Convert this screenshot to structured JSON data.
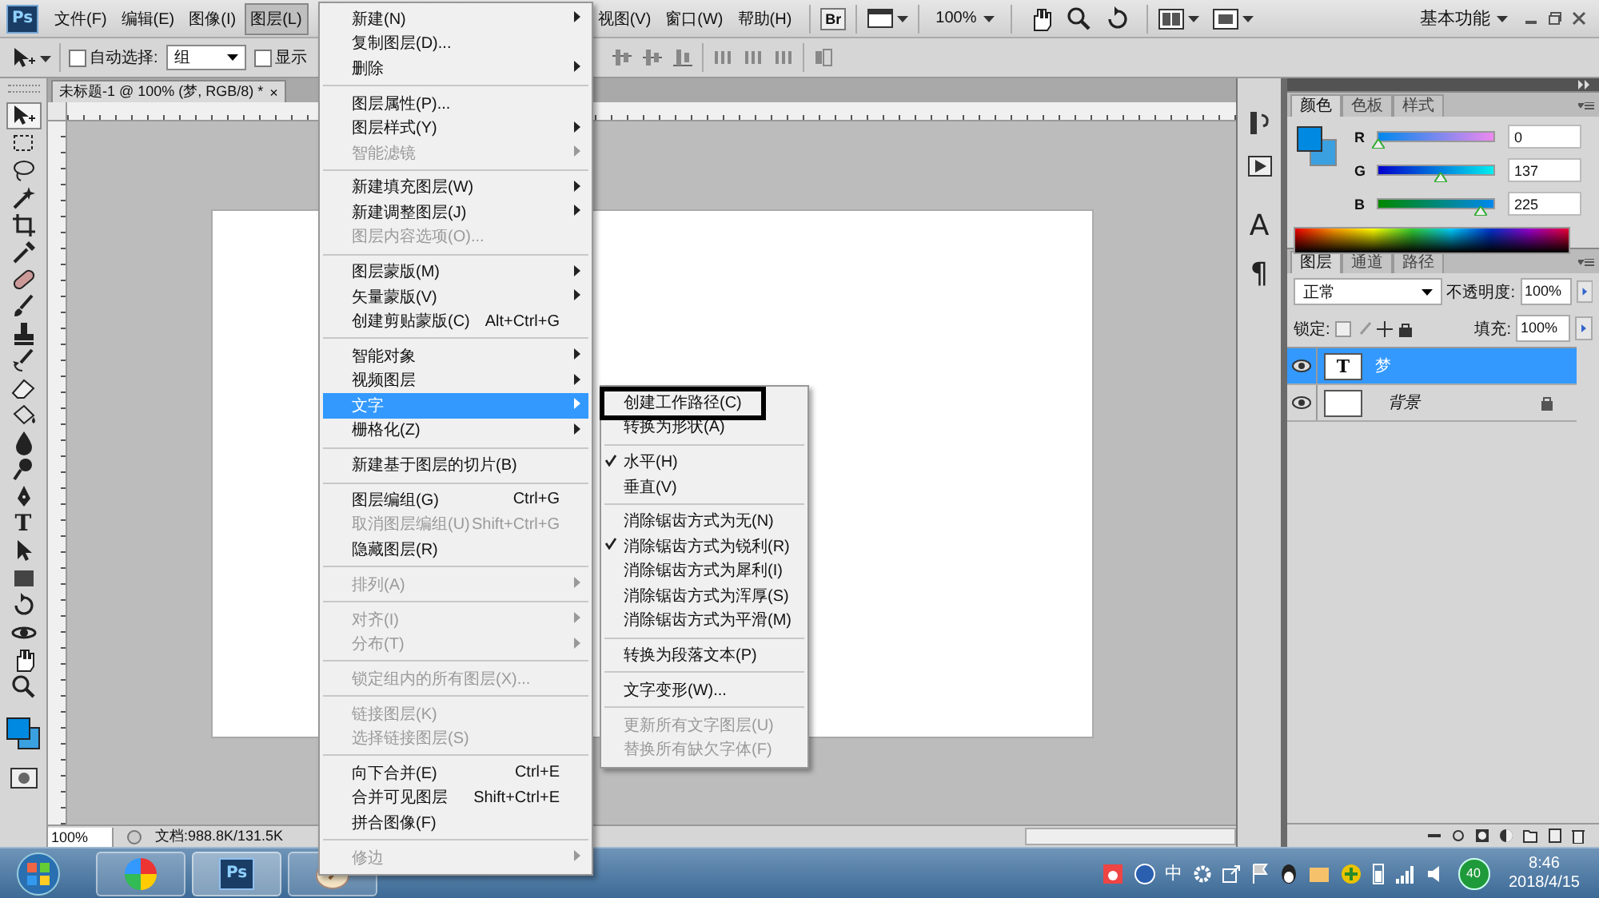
{
  "menubar": {
    "items": [
      {
        "label": "文件(F)",
        "selected": false
      },
      {
        "label": "编辑(E)",
        "selected": false
      },
      {
        "label": "图像(I)",
        "selected": false
      },
      {
        "label": "图层(L)",
        "selected": true
      },
      {
        "label": "视图(V)",
        "selected": false
      },
      {
        "label": "窗口(W)",
        "selected": false
      },
      {
        "label": "帮助(H)",
        "selected": false
      }
    ],
    "logo": "Ps",
    "bridge": "Br",
    "zoom": "100%",
    "workspace": "基本功能"
  },
  "options_bar": {
    "auto_select": {
      "label": "自动选择:",
      "checked": false
    },
    "group_select": {
      "value": "组"
    },
    "show_transform": {
      "label": "显示",
      "checked": false
    }
  },
  "toolbox": {
    "tools": [
      {
        "kind": "move",
        "selected": true
      },
      {
        "kind": "marquee",
        "selected": false
      },
      {
        "kind": "lasso",
        "selected": false
      },
      {
        "kind": "wand",
        "selected": false
      },
      {
        "kind": "crop",
        "selected": false
      },
      {
        "kind": "eyedropper",
        "selected": false
      },
      {
        "kind": "healing",
        "selected": false
      },
      {
        "kind": "brush",
        "selected": false
      },
      {
        "kind": "stamp",
        "selected": false
      },
      {
        "kind": "history",
        "selected": false
      },
      {
        "kind": "eraser",
        "selected": false
      },
      {
        "kind": "bucket",
        "selected": false
      },
      {
        "kind": "drop",
        "selected": false
      },
      {
        "kind": "dodge",
        "selected": false
      },
      {
        "kind": "pen",
        "selected": false
      },
      {
        "kind": "text",
        "glyph": "T",
        "selected": false
      },
      {
        "kind": "path",
        "selected": false
      },
      {
        "kind": "shape",
        "selected": false
      },
      {
        "kind": "rotate",
        "selected": false
      },
      {
        "kind": "orbit",
        "selected": false
      },
      {
        "kind": "hand",
        "selected": false
      },
      {
        "kind": "zoom",
        "selected": false
      }
    ]
  },
  "document": {
    "tab_title": "未标题-1 @ 100% (梦, RGB/8) *",
    "close_glyph": "×",
    "zoom": "100%",
    "doc_size": "文档:988.8K/131.5K"
  },
  "dock": {
    "items": [
      {
        "kind": "history"
      },
      {
        "kind": "actions"
      },
      {
        "kind": "character",
        "glyph": "A"
      },
      {
        "kind": "paragraph",
        "glyph": "¶"
      }
    ]
  },
  "color_panel": {
    "tabs": [
      {
        "label": "颜色",
        "selected": true
      },
      {
        "label": "色板",
        "selected": false
      },
      {
        "label": "样式",
        "selected": false
      }
    ],
    "channels": [
      {
        "name": "R",
        "level": 0,
        "value": "0"
      },
      {
        "name": "G",
        "level": 0.537,
        "value": "137"
      },
      {
        "name": "B",
        "level": 0.882,
        "value": "225"
      }
    ]
  },
  "layers_panel": {
    "tabs": [
      {
        "label": "图层",
        "selected": true
      },
      {
        "label": "通道",
        "selected": false
      },
      {
        "label": "路径",
        "selected": false
      }
    ],
    "blend_mode": "正常",
    "opacity_label": "不透明度:",
    "opacity": "100%",
    "lock_label": "锁定:",
    "fill_label": "填充:",
    "fill": "100%",
    "layers": [
      {
        "name": "梦",
        "kind": "text",
        "thumb": "T",
        "selected": true,
        "visible": true,
        "locked": false
      },
      {
        "name": "背景",
        "kind": "background",
        "selected": false,
        "visible": true,
        "locked": true
      }
    ]
  },
  "layer_menu": {
    "items": [
      {
        "kind": "item",
        "label": "新建(N)",
        "submenu": true,
        "disabled": false,
        "selected": false
      },
      {
        "kind": "item",
        "label": "复制图层(D)...",
        "submenu": false,
        "disabled": false,
        "selected": false
      },
      {
        "kind": "item",
        "label": "删除",
        "submenu": true,
        "disabled": false,
        "selected": false
      },
      {
        "kind": "separator"
      },
      {
        "kind": "item",
        "label": "图层属性(P)...",
        "submenu": false,
        "disabled": false,
        "selected": false
      },
      {
        "kind": "item",
        "label": "图层样式(Y)",
        "submenu": true,
        "disabled": false,
        "selected": false
      },
      {
        "kind": "item",
        "label": "智能滤镜",
        "submenu": true,
        "disabled": true,
        "selected": false
      },
      {
        "kind": "separator"
      },
      {
        "kind": "item",
        "label": "新建填充图层(W)",
        "submenu": true,
        "disabled": false,
        "selected": false
      },
      {
        "kind": "item",
        "label": "新建调整图层(J)",
        "submenu": true,
        "disabled": false,
        "selected": false
      },
      {
        "kind": "item",
        "label": "图层内容选项(O)...",
        "submenu": false,
        "disabled": true,
        "selected": false
      },
      {
        "kind": "separator"
      },
      {
        "kind": "item",
        "label": "图层蒙版(M)",
        "submenu": true,
        "disabled": false,
        "selected": false
      },
      {
        "kind": "item",
        "label": "矢量蒙版(V)",
        "submenu": true,
        "disabled": false,
        "selected": false
      },
      {
        "kind": "item",
        "label": "创建剪贴蒙版(C)",
        "shortcut": "Alt+Ctrl+G",
        "submenu": false,
        "disabled": false,
        "selected": false
      },
      {
        "kind": "separator"
      },
      {
        "kind": "item",
        "label": "智能对象",
        "submenu": true,
        "disabled": false,
        "selected": false
      },
      {
        "kind": "item",
        "label": "视频图层",
        "submenu": true,
        "disabled": false,
        "selected": false
      },
      {
        "kind": "item",
        "label": "文字",
        "submenu": true,
        "disabled": false,
        "selected": true
      },
      {
        "kind": "item",
        "label": "栅格化(Z)",
        "submenu": true,
        "disabled": false,
        "selected": false
      },
      {
        "kind": "separator"
      },
      {
        "kind": "item",
        "label": "新建基于图层的切片(B)",
        "submenu": false,
        "disabled": false,
        "selected": false
      },
      {
        "kind": "separator"
      },
      {
        "kind": "item",
        "label": "图层编组(G)",
        "shortcut": "Ctrl+G",
        "submenu": false,
        "disabled": false,
        "selected": false
      },
      {
        "kind": "item",
        "label": "取消图层编组(U)",
        "shortcut": "Shift+Ctrl+G",
        "submenu": false,
        "disabled": true,
        "selected": false
      },
      {
        "kind": "item",
        "label": "隐藏图层(R)",
        "submenu": false,
        "disabled": false,
        "selected": false
      },
      {
        "kind": "separator"
      },
      {
        "kind": "item",
        "label": "排列(A)",
        "submenu": true,
        "disabled": true,
        "selected": false
      },
      {
        "kind": "separator"
      },
      {
        "kind": "item",
        "label": "对齐(I)",
        "submenu": true,
        "disabled": true,
        "selected": false
      },
      {
        "kind": "item",
        "label": "分布(T)",
        "submenu": true,
        "disabled": true,
        "selected": false
      },
      {
        "kind": "separator"
      },
      {
        "kind": "item",
        "label": "锁定组内的所有图层(X)...",
        "submenu": false,
        "disabled": true,
        "selected": false
      },
      {
        "kind": "separator"
      },
      {
        "kind": "item",
        "label": "链接图层(K)",
        "submenu": false,
        "disabled": true,
        "selected": false
      },
      {
        "kind": "item",
        "label": "选择链接图层(S)",
        "submenu": false,
        "disabled": true,
        "selected": false
      },
      {
        "kind": "separator"
      },
      {
        "kind": "item",
        "label": "向下合并(E)",
        "shortcut": "Ctrl+E",
        "submenu": false,
        "disabled": false,
        "selected": false
      },
      {
        "kind": "item",
        "label": "合并可见图层",
        "shortcut": "Shift+Ctrl+E",
        "submenu": false,
        "disabled": false,
        "selected": false
      },
      {
        "kind": "item",
        "label": "拼合图像(F)",
        "submenu": false,
        "disabled": false,
        "selected": false
      },
      {
        "kind": "separator"
      },
      {
        "kind": "item",
        "label": "修边",
        "submenu": true,
        "disabled": true,
        "selected": false
      }
    ]
  },
  "text_menu": {
    "items": [
      {
        "kind": "item",
        "label": "创建工作路径(C)",
        "checked": false,
        "disabled": false,
        "framed": true
      },
      {
        "kind": "item",
        "label": "转换为形状(A)",
        "checked": false,
        "disabled": false,
        "framed": false
      },
      {
        "kind": "separator"
      },
      {
        "kind": "item",
        "label": "水平(H)",
        "checked": true,
        "disabled": false,
        "framed": false
      },
      {
        "kind": "item",
        "label": "垂直(V)",
        "checked": false,
        "disabled": false,
        "framed": false
      },
      {
        "kind": "separator"
      },
      {
        "kind": "item",
        "label": "消除锯齿方式为无(N)",
        "checked": false,
        "disabled": false,
        "framed": false
      },
      {
        "kind": "item",
        "label": "消除锯齿方式为锐利(R)",
        "checked": true,
        "disabled": false,
        "framed": false
      },
      {
        "kind": "item",
        "label": "消除锯齿方式为犀利(I)",
        "checked": false,
        "disabled": false,
        "framed": false
      },
      {
        "kind": "item",
        "label": "消除锯齿方式为浑厚(S)",
        "checked": false,
        "disabled": false,
        "framed": false
      },
      {
        "kind": "item",
        "label": "消除锯齿方式为平滑(M)",
        "checked": false,
        "disabled": false,
        "framed": false
      },
      {
        "kind": "separator"
      },
      {
        "kind": "item",
        "label": "转换为段落文本(P)",
        "checked": false,
        "disabled": false,
        "framed": false
      },
      {
        "kind": "separator"
      },
      {
        "kind": "item",
        "label": "文字变形(W)...",
        "checked": false,
        "disabled": false,
        "framed": false
      },
      {
        "kind": "separator"
      },
      {
        "kind": "item",
        "label": "更新所有文字图层(U)",
        "checked": false,
        "disabled": true,
        "framed": false
      },
      {
        "kind": "item",
        "label": "替换所有缺欠字体(F)",
        "checked": false,
        "disabled": true,
        "framed": false
      }
    ]
  },
  "taskbar": {
    "apps": [
      {
        "kind": "pinwheel",
        "selected": false
      },
      {
        "kind": "photoshop",
        "label": "Ps",
        "selected": true
      },
      {
        "kind": "paint",
        "selected": false
      }
    ],
    "ime": "中",
    "badge": "40",
    "time": "8:46",
    "date": "2018/4/15"
  }
}
